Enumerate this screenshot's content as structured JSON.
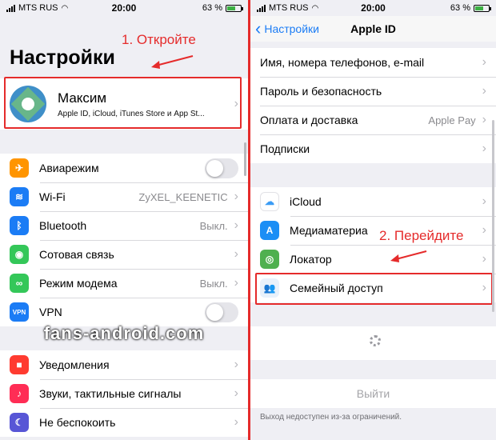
{
  "status_left": {
    "carrier": "MTS RUS",
    "time": "20:00",
    "battery": "63 %"
  },
  "status_right": {
    "carrier": "MTS RUS",
    "time": "20:00",
    "battery": "63 %"
  },
  "settings": {
    "title": "Настройки",
    "annotation1": "1. Откройте",
    "profile": {
      "name": "Максим",
      "subtitle": "Apple ID, iCloud, iTunes Store и App St..."
    },
    "group1": [
      {
        "label": "Авиарежим",
        "icon": "airplane-icon",
        "color": "#ff9500",
        "glyph": "✈",
        "toggle": true
      },
      {
        "label": "Wi-Fi",
        "icon": "wifi-icon",
        "color": "#1b7cf5",
        "glyph": "≋",
        "value": "ZyXEL_KEENETIC"
      },
      {
        "label": "Bluetooth",
        "icon": "bluetooth-icon",
        "color": "#1b7cf5",
        "glyph": "ᛒ",
        "value": "Выкл."
      },
      {
        "label": "Сотовая связь",
        "icon": "cellular-icon",
        "color": "#34c759",
        "glyph": "◉"
      },
      {
        "label": "Режим модема",
        "icon": "hotspot-icon",
        "color": "#34c759",
        "glyph": "∞",
        "value": "Выкл."
      },
      {
        "label": "VPN",
        "icon": "vpn-icon",
        "color": "#1b7cf5",
        "glyph": "VPN",
        "toggle": true
      }
    ],
    "group2": [
      {
        "label": "Уведомления",
        "icon": "notifications-icon",
        "color": "#ff3b30",
        "glyph": "■"
      },
      {
        "label": "Звуки, тактильные сигналы",
        "icon": "sounds-icon",
        "color": "#ff2d55",
        "glyph": "♪"
      },
      {
        "label": "Не беспокоить",
        "icon": "moon-icon",
        "color": "#5856d6",
        "glyph": "☾"
      }
    ],
    "watermark": "fans-android.com"
  },
  "appleid": {
    "back_label": "Настройки",
    "title": "Apple ID",
    "group1": [
      {
        "label": "Имя, номера телефонов, e-mail"
      },
      {
        "label": "Пароль и безопасность"
      },
      {
        "label": "Оплата и доставка",
        "value": "Apple Pay"
      },
      {
        "label": "Подписки"
      }
    ],
    "group2": [
      {
        "label": "iCloud",
        "icon": "icloud-icon",
        "color": "#ffffff",
        "glyph": "☁",
        "glyph_color": "#3b9cf5"
      },
      {
        "label": "Медиаматериа",
        "icon": "app-store-icon",
        "color": "#1b8ef5",
        "glyph": "A"
      },
      {
        "label": "Локатор",
        "icon": "find-my-icon",
        "color": "#4fb04f",
        "glyph": "◎"
      },
      {
        "label": "Семейный доступ",
        "icon": "family-sharing-icon",
        "color": "#e8f1fb",
        "glyph": "👥",
        "glyph_color": "#5b8fd8"
      }
    ],
    "annotation2": "2. Перейдите",
    "logout": "Выйти",
    "note": "Выход недоступен из-за ограничений."
  }
}
